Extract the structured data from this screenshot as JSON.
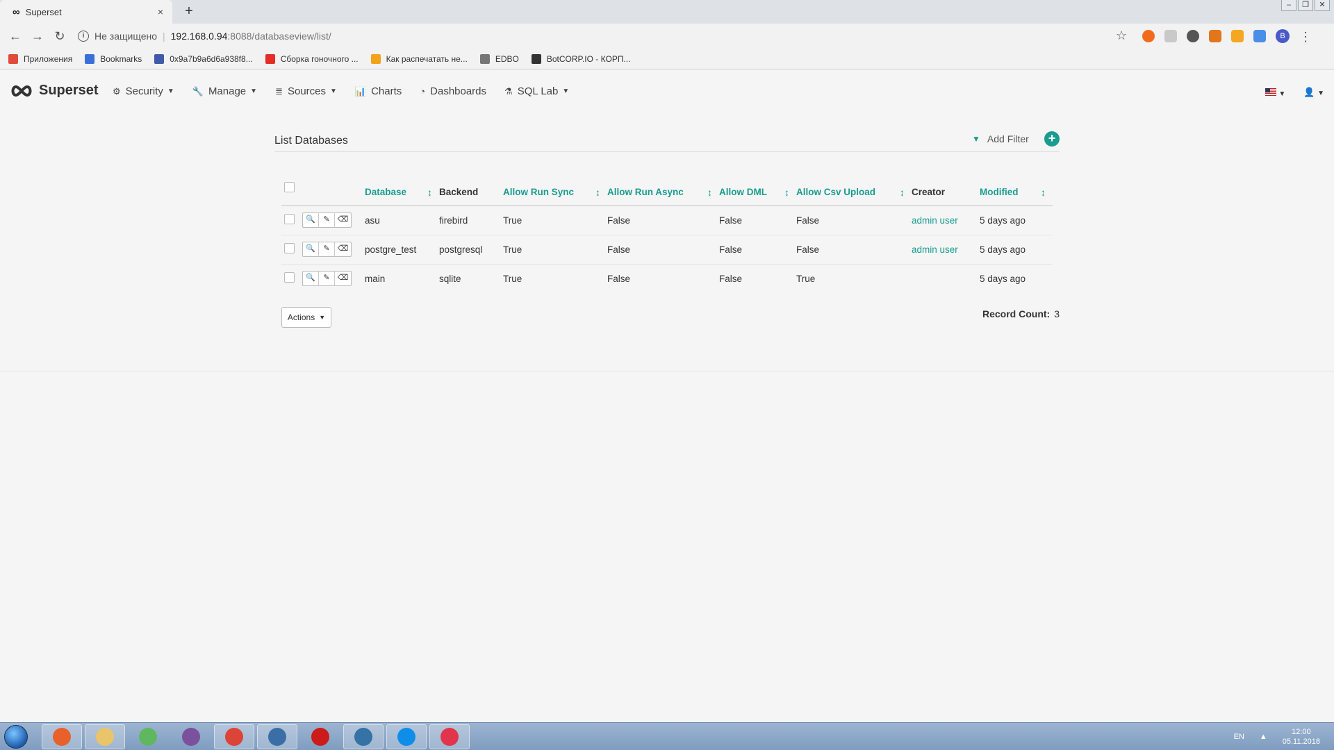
{
  "browser": {
    "tab_title": "Superset",
    "tab_close": "×",
    "new_tab": "+",
    "insecure_label": "Не защищено",
    "url_host": "192.168.0.94",
    "url_path": ":8088/databaseview/list/",
    "profile_initial": "B",
    "bookmarks": [
      {
        "label": "Приложения",
        "icon": "apps-grid-icon",
        "color": "#e04b3a"
      },
      {
        "label": "Bookmarks",
        "icon": "star-icon",
        "color": "#3b6fd8"
      },
      {
        "label": "0x9a7b9a6d6a938f8...",
        "icon": "coin-icon",
        "color": "#3f5aa8"
      },
      {
        "label": "Сборка гоночного ...",
        "icon": "youtube-icon",
        "color": "#e52d27"
      },
      {
        "label": "Как распечатать не...",
        "icon": "windows-icon",
        "color": "#f3a21b"
      },
      {
        "label": "EDBO",
        "icon": "page-icon",
        "color": "#777777"
      },
      {
        "label": "BotCORP.IO - КОРП...",
        "icon": "bot-icon",
        "color": "#333333"
      }
    ]
  },
  "app": {
    "brand": "Superset",
    "menu": [
      {
        "label": "Security",
        "icon": "cogs-icon",
        "dropdown": true
      },
      {
        "label": "Manage",
        "icon": "wrench-icon",
        "dropdown": true
      },
      {
        "label": "Sources",
        "icon": "database-icon",
        "dropdown": true
      },
      {
        "label": "Charts",
        "icon": "bar-chart-icon",
        "dropdown": false
      },
      {
        "label": "Dashboards",
        "icon": "dashboard-icon",
        "dropdown": false
      },
      {
        "label": "SQL Lab",
        "icon": "flask-icon",
        "dropdown": true
      }
    ]
  },
  "list": {
    "title": "List Databases",
    "add_filter": "Add Filter",
    "columns": [
      "Database",
      "Backend",
      "Allow Run Sync",
      "Allow Run Async",
      "Allow DML",
      "Allow Csv Upload",
      "Creator",
      "Modified"
    ],
    "rows": [
      {
        "database": "asu",
        "backend": "firebird",
        "allow_run_sync": "True",
        "allow_run_async": "False",
        "allow_dml": "False",
        "allow_csv_upload": "False",
        "creator": "admin user",
        "modified": "5 days ago"
      },
      {
        "database": "postgre_test",
        "backend": "postgresql",
        "allow_run_sync": "True",
        "allow_run_async": "False",
        "allow_dml": "False",
        "allow_csv_upload": "False",
        "creator": "admin user",
        "modified": "5 days ago"
      },
      {
        "database": "main",
        "backend": "sqlite",
        "allow_run_sync": "True",
        "allow_run_async": "False",
        "allow_dml": "False",
        "allow_csv_upload": "True",
        "creator": "",
        "modified": "5 days ago"
      }
    ],
    "actions_label": "Actions",
    "record_count_label": "Record Count:",
    "record_count": "3"
  },
  "taskbar": {
    "apps": [
      {
        "name": "firefox",
        "color": "#e8612c"
      },
      {
        "name": "file-explorer",
        "color": "#e9c46a"
      },
      {
        "name": "network-app",
        "color": "#5fb85f"
      },
      {
        "name": "viber",
        "color": "#7b519d"
      },
      {
        "name": "chrome",
        "color": "#db4437"
      },
      {
        "name": "remote-desktop",
        "color": "#3a6ea5"
      },
      {
        "name": "opera",
        "color": "#cc1b1b"
      },
      {
        "name": "python",
        "color": "#3572a5"
      },
      {
        "name": "teamviewer",
        "color": "#0e8ee9"
      },
      {
        "name": "screen-recorder",
        "color": "#e0354b"
      }
    ],
    "lang": "EN",
    "time": "12:00",
    "date": "05.11.2018"
  }
}
